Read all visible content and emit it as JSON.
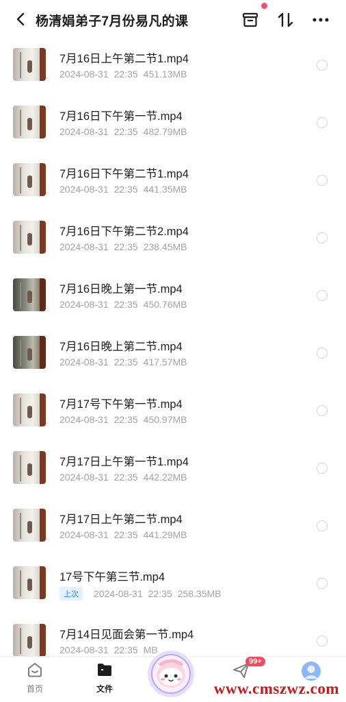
{
  "header": {
    "title": "杨清娟弟子7月份易凡的课"
  },
  "files": [
    {
      "name": "7月16日上午第二节1.mp4",
      "date": "2024-08-31",
      "time": "22:35",
      "size": "451.13MB",
      "badge": ""
    },
    {
      "name": "7月16日下午第一节.mp4",
      "date": "2024-08-31",
      "time": "22:35",
      "size": "482.79MB",
      "badge": ""
    },
    {
      "name": "7月16日下午第二节1.mp4",
      "date": "2024-08-31",
      "time": "22:35",
      "size": "441.35MB",
      "badge": ""
    },
    {
      "name": "7月16日下午第二节2.mp4",
      "date": "2024-08-31",
      "time": "22:35",
      "size": "238.45MB",
      "badge": ""
    },
    {
      "name": "7月16日晚上第一节.mp4",
      "date": "2024-08-31",
      "time": "22:35",
      "size": "450.76MB",
      "badge": ""
    },
    {
      "name": "7月16日晚上第二节.mp4",
      "date": "2024-08-31",
      "time": "22:35",
      "size": "417.57MB",
      "badge": ""
    },
    {
      "name": "7月17号下午第一节.mp4",
      "date": "2024-08-31",
      "time": "22:35",
      "size": "450.97MB",
      "badge": ""
    },
    {
      "name": "7月17日上午第一节1.mp4",
      "date": "2024-08-31",
      "time": "22:35",
      "size": "442.22MB",
      "badge": ""
    },
    {
      "name": "7月17日上午第二节.mp4",
      "date": "2024-08-31",
      "time": "22:35",
      "size": "441.29MB",
      "badge": ""
    },
    {
      "name": "17号下午第三节.mp4",
      "date": "2024-08-31",
      "time": "22:35",
      "size": "258.35MB",
      "badge": "上次"
    },
    {
      "name": "7月14日见面会第一节.mp4",
      "date": "2024-08-31",
      "time": "22:35",
      "size": "MB",
      "badge": ""
    }
  ],
  "bottom_nav": {
    "home_label": "首页",
    "files_label": "文件",
    "send_badge": "99+"
  },
  "watermark": "www.cmszwz.com",
  "colors": {
    "accent_red": "#f4495c",
    "badge_blue": "#3a8bff",
    "watermark_red": "#c61a1a"
  }
}
